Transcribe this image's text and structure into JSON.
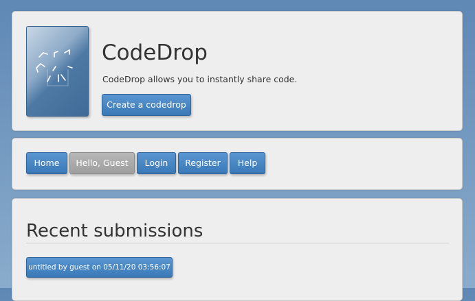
{
  "header": {
    "logo_icon": "codedrop-logo-icon",
    "title": "CodeDrop",
    "subtitle": "CodeDrop allows you to instantly share code.",
    "create_button": "Create a codedrop"
  },
  "nav": {
    "items": [
      {
        "label": "Home",
        "style": "blue"
      },
      {
        "label": "Hello, Guest",
        "style": "gray"
      },
      {
        "label": "Login",
        "style": "blue"
      },
      {
        "label": "Register",
        "style": "blue"
      },
      {
        "label": "Help",
        "style": "blue"
      }
    ]
  },
  "recent": {
    "title": "Recent submissions",
    "submissions": [
      {
        "label": "untitled by guest on 05/11/20 03:56:07"
      }
    ]
  },
  "colors": {
    "accent": "#3a78b7",
    "accent_border": "#2f659b",
    "panel_bg": "#eeeeee",
    "page_bg": "#6f96c0",
    "gray_button": "#a8a8a8"
  }
}
